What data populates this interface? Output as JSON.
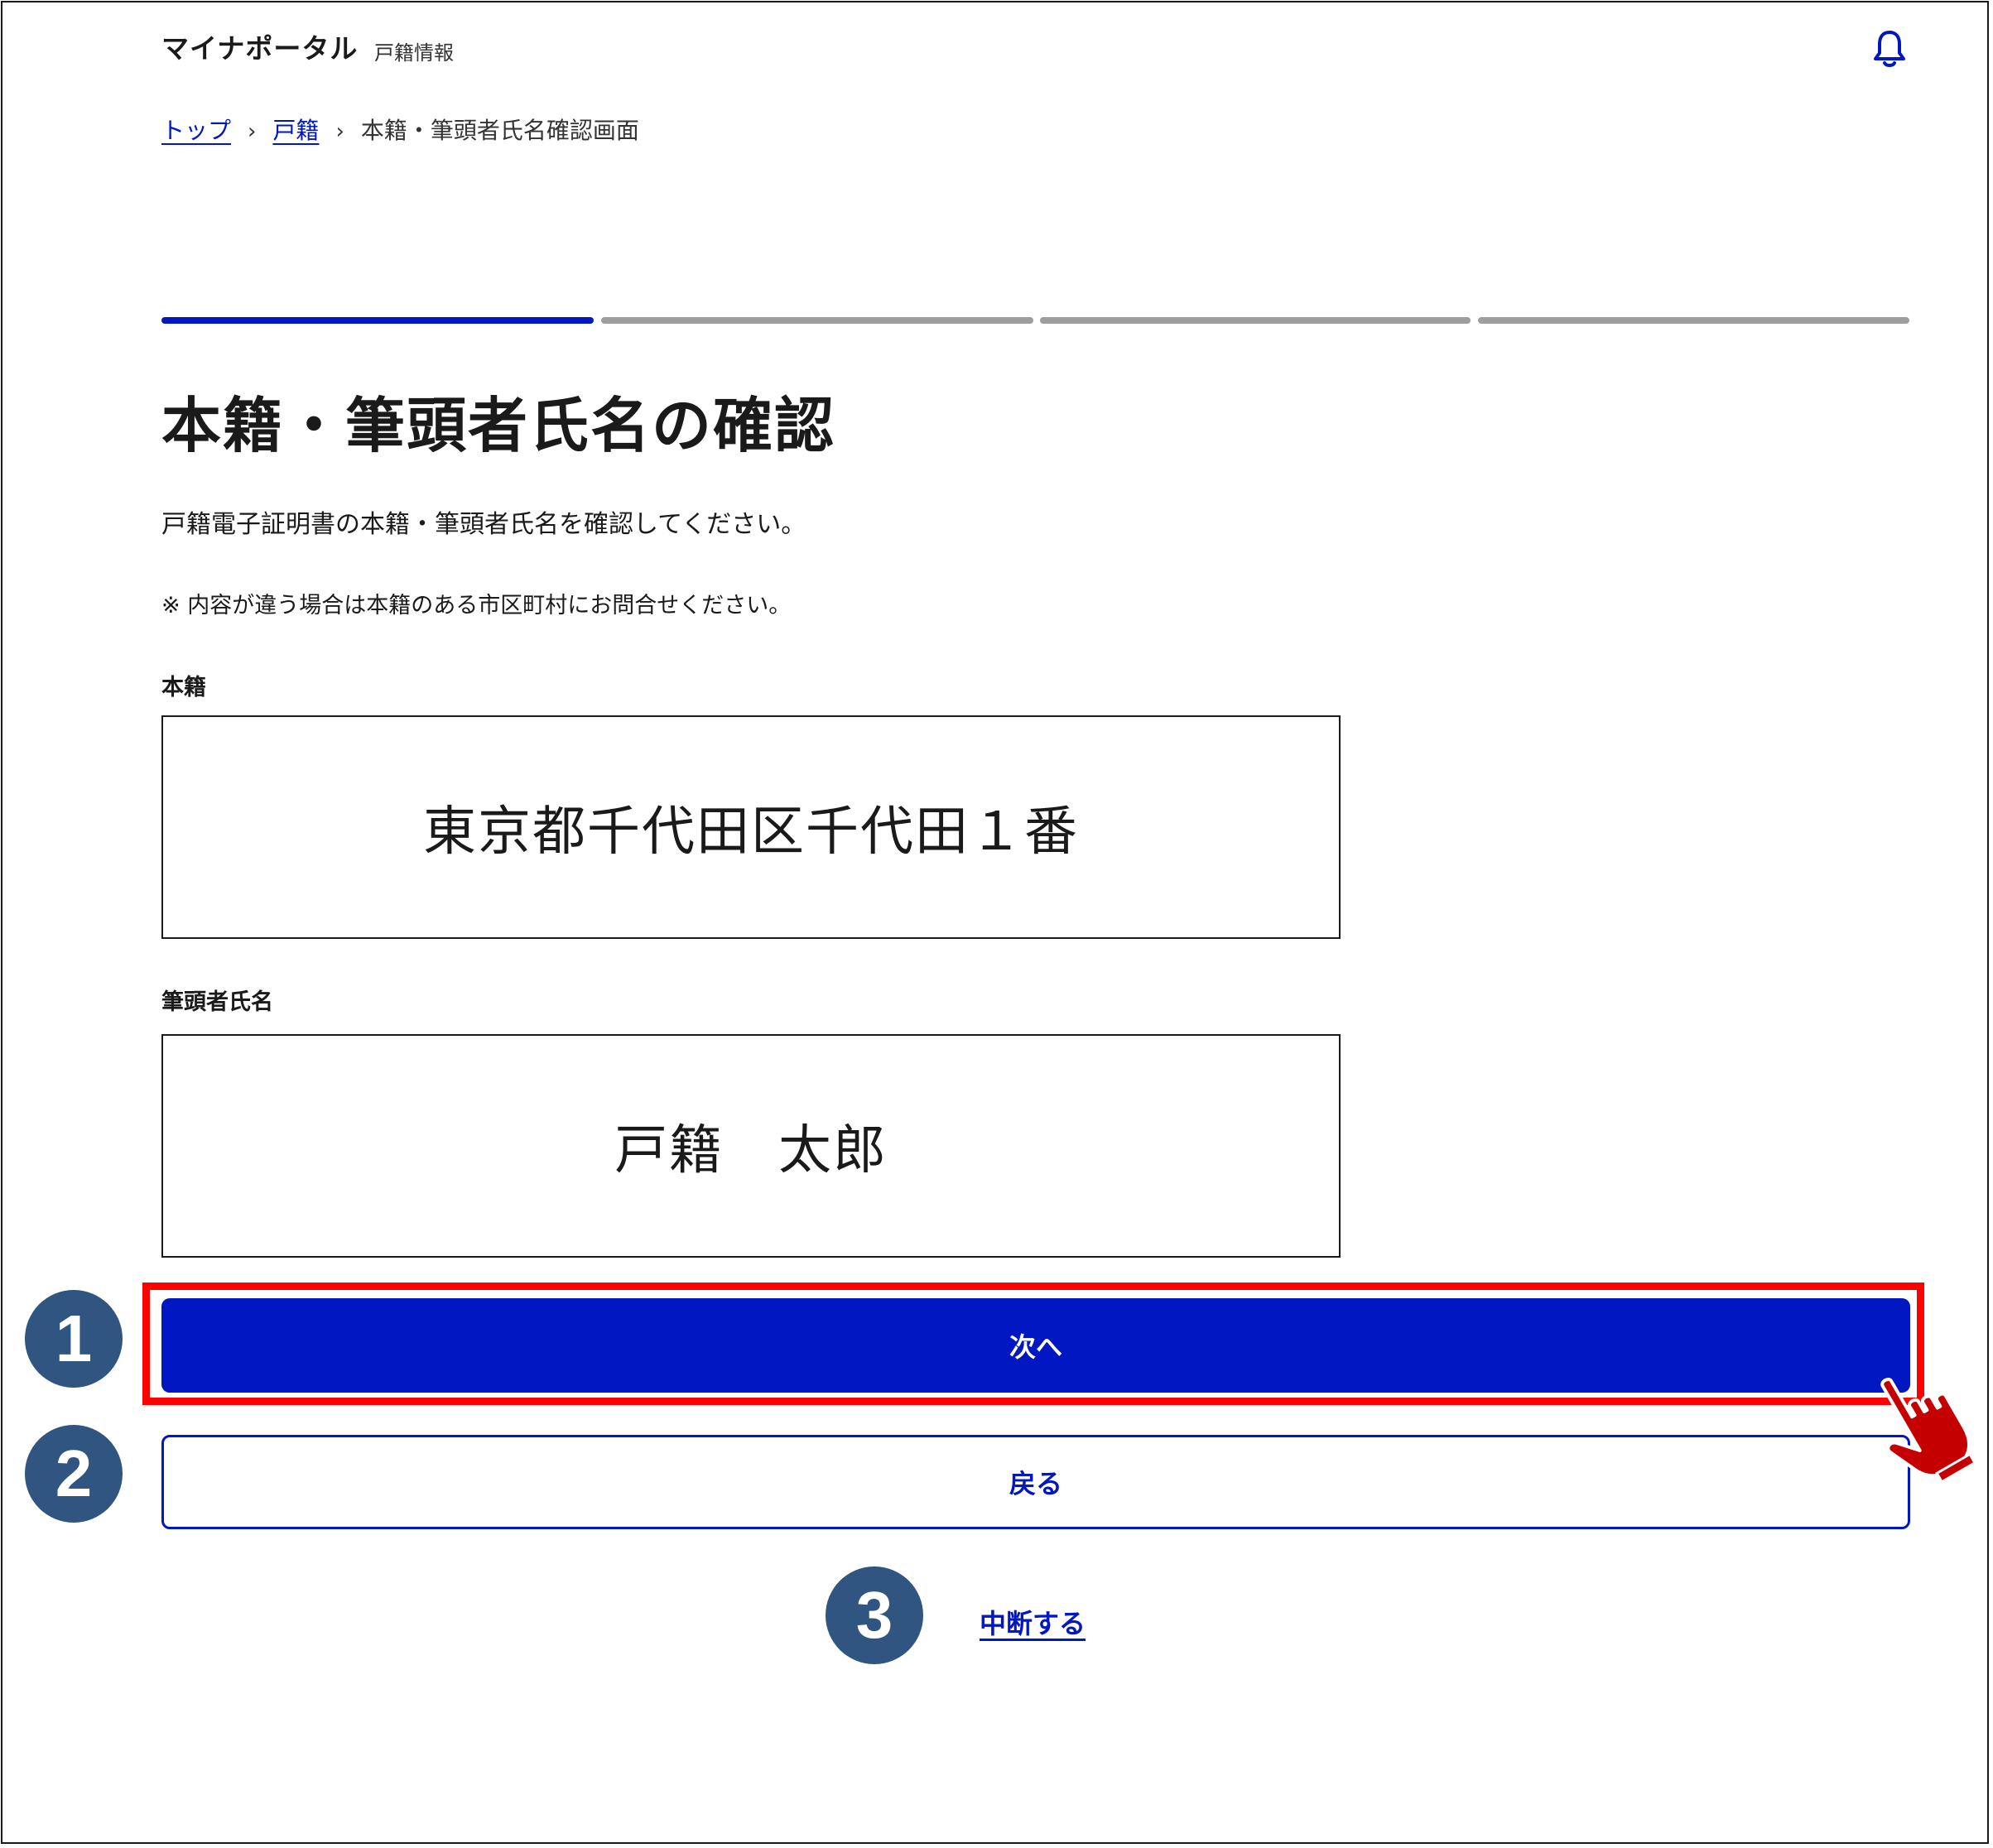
{
  "header": {
    "app_title": "マイナポータル",
    "app_subtitle": "戸籍情報",
    "notification_icon": "bell-icon"
  },
  "breadcrumb": {
    "items": [
      {
        "label": "トップ",
        "link": true
      },
      {
        "label": "戸籍",
        "link": true
      },
      {
        "label": "本籍・筆頭者氏名確認画面",
        "link": false
      }
    ],
    "separator": "›"
  },
  "progress": {
    "total_steps": 4,
    "current_step": 1,
    "active_color": "#0017c1",
    "inactive_color": "#9e9e9e"
  },
  "main": {
    "title": "本籍・筆頭者氏名の確認",
    "description": "戸籍電子証明書の本籍・筆頭者氏名を確認してください。",
    "note": "※ 内容が違う場合は本籍のある市区町村にお問合せください。",
    "honseki": {
      "label": "本籍",
      "value": "東京都千代田区千代田１番"
    },
    "hittousha": {
      "label": "筆頭者氏名",
      "value": "戸籍　太郎"
    }
  },
  "actions": {
    "next_label": "次へ",
    "back_label": "戻る",
    "abort_label": "中断する"
  },
  "annotations": {
    "markers": [
      "1",
      "2",
      "3"
    ],
    "highlight_color": "#ff0000",
    "marker_color": "#2f5580",
    "cursor_icon": "pointing-hand-icon"
  },
  "colors": {
    "primary": "#0017c1",
    "text": "#1a1a1a"
  }
}
